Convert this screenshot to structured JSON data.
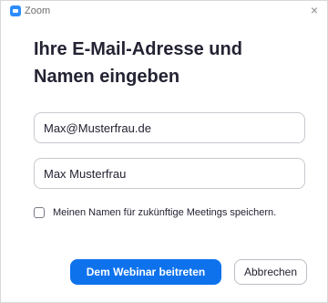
{
  "window": {
    "title": "Zoom",
    "close_glyph": "×",
    "icon": "zoom-app-icon"
  },
  "dialog": {
    "heading_line1": "Ihre E-Mail-Adresse und",
    "heading_line2": "Namen eingeben",
    "email_value": "Max@Musterfrau.de",
    "name_value": "Max Musterfrau",
    "remember_checked": false,
    "remember_label": "Meinen Namen für zukünftige Meetings speichern.",
    "join_button_label": "Dem Webinar beitreten",
    "cancel_button_label": "Abbrechen"
  },
  "colors": {
    "accent": "#0e72ed",
    "app_icon": "#2d8cff",
    "text": "#232333"
  }
}
